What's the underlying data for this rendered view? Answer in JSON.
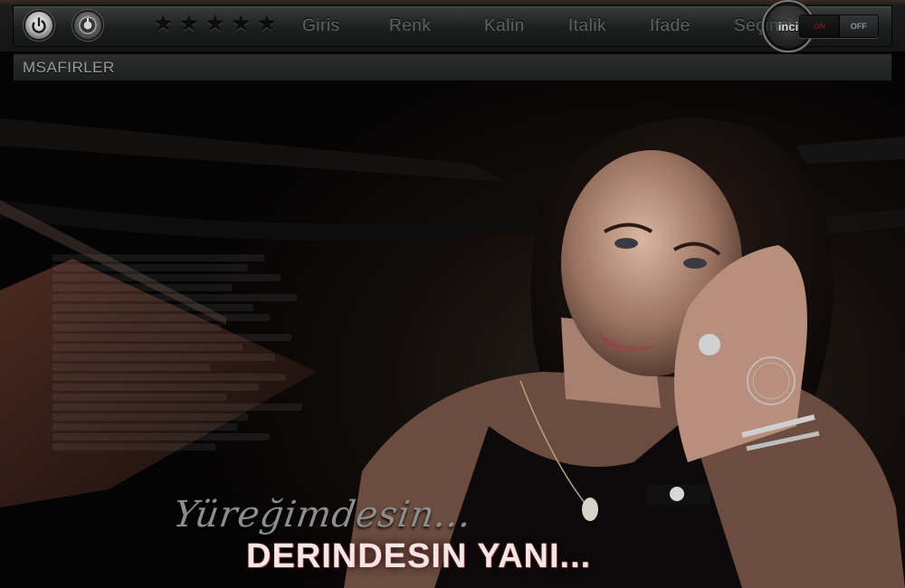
{
  "toolbar": {
    "buttons": {
      "power": "power-icon",
      "volume": "volume-knob-icon"
    },
    "rating_stars": [
      "★",
      "★",
      "★",
      "★",
      "★"
    ],
    "menu": {
      "giris": "Giris",
      "renk": "Renk",
      "kalin": "Kalin",
      "italik": "Italik",
      "ifade": "Ifade",
      "secinci": "Seçinci"
    },
    "badge": "inci",
    "toggle": {
      "on": "ON",
      "off": "OFF"
    }
  },
  "subbar": {
    "title": "MSAFIRLER"
  },
  "hero": {
    "script_text": "Yüreğimdesin...",
    "headline": "DERINDESIN YANI..."
  },
  "colors": {
    "background": "#050404",
    "menu_text": "#5d6163",
    "headline_glow": "#b03a3a"
  }
}
